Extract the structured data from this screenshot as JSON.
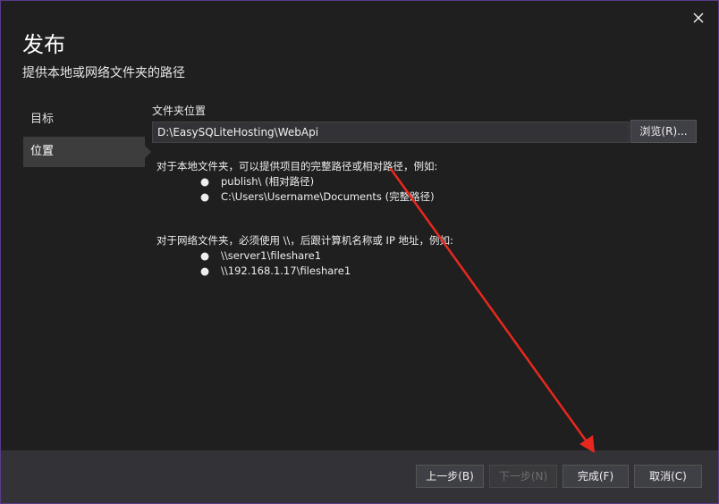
{
  "dialog": {
    "title": "发布",
    "subtitle": "提供本地或网络文件夹的路径"
  },
  "nav": {
    "items": [
      {
        "label": "目标",
        "selected": false
      },
      {
        "label": "位置",
        "selected": true
      }
    ]
  },
  "location": {
    "field_label": "文件夹位置",
    "path_value": "D:\\EasySQLiteHosting\\WebApi",
    "browse_label": "浏览(R)..."
  },
  "help": {
    "local_intro": "对于本地文件夹，可以提供项目的完整路径或相对路径，例如:",
    "local_examples": [
      "publish\\ (相对路径)",
      "C:\\Users\\Username\\Documents (完整路径)"
    ],
    "network_intro": "对于网络文件夹，必须使用 \\\\，后跟计算机名称或 IP 地址，例如:",
    "network_examples": [
      "\\\\server1\\fileshare1",
      "\\\\192.168.1.17\\fileshare1"
    ],
    "bullet": "●"
  },
  "footer": {
    "prev_label": "上一步(B)",
    "next_label": "下一步(N)",
    "finish_label": "完成(F)",
    "cancel_label": "取消(C)"
  },
  "colors": {
    "background": "#1f1f1f",
    "footer": "#333337",
    "border": "#5a3a8a",
    "annotation_arrow": "#e8281e"
  },
  "icons": {
    "close": "close-icon"
  }
}
